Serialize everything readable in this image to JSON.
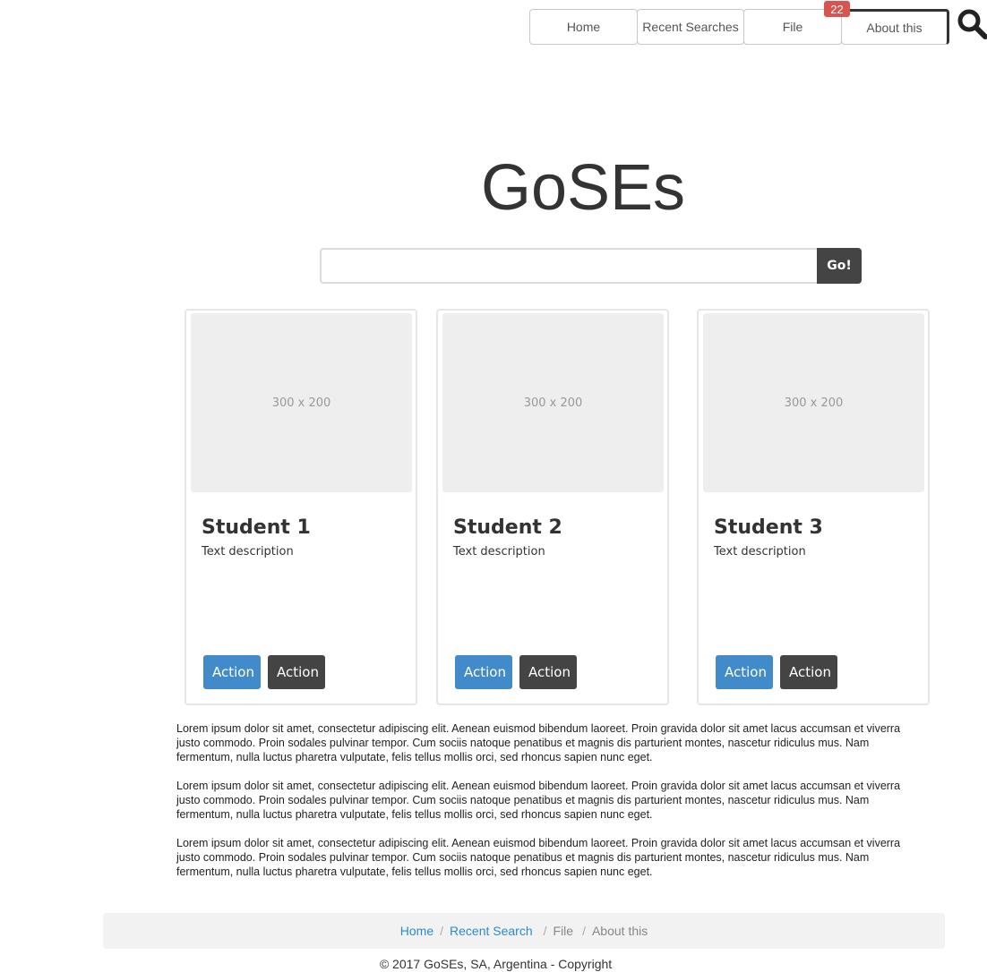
{
  "nav": {
    "items": [
      {
        "label": "Home"
      },
      {
        "label": "Recent Searches"
      },
      {
        "label": "File"
      },
      {
        "label": "About this"
      }
    ],
    "badge": "22"
  },
  "icons": {
    "search": "search-icon"
  },
  "hero": {
    "title": "GoSEs",
    "search_value": "",
    "search_placeholder": "",
    "go_label": "Go!"
  },
  "cards": [
    {
      "thumb": "300 x 200",
      "title": "Student 1",
      "description": "Text description",
      "action1": "Action",
      "action2": "Action"
    },
    {
      "thumb": "300 x 200",
      "title": "Student 2",
      "description": "Text description",
      "action1": "Action",
      "action2": "Action"
    },
    {
      "thumb": "300 x 200",
      "title": "Student 3",
      "description": "Text description",
      "action1": "Action",
      "action2": "Action"
    }
  ],
  "paragraphs": [
    "Lorem ipsum dolor sit amet, consectetur adipiscing elit. Aenean euismod bibendum laoreet. Proin gravida dolor sit amet lacus accumsan et viverra justo commodo. Proin sodales pulvinar tempor. Cum sociis natoque penatibus et magnis dis parturient montes, nascetur ridiculus mus. Nam fermentum, nulla luctus pharetra vulputate, felis tellus mollis orci, sed rhoncus sapien nunc eget.",
    "Lorem ipsum dolor sit amet, consectetur adipiscing elit. Aenean euismod bibendum laoreet. Proin gravida dolor sit amet lacus accumsan et viverra justo commodo. Proin sodales pulvinar tempor. Cum sociis natoque penatibus et magnis dis parturient montes, nascetur ridiculus mus. Nam fermentum, nulla luctus pharetra vulputate, felis tellus mollis orci, sed rhoncus sapien nunc eget.",
    "Lorem ipsum dolor sit amet, consectetur adipiscing elit. Aenean euismod bibendum laoreet. Proin gravida dolor sit amet lacus accumsan et viverra justo commodo. Proin sodales pulvinar tempor. Cum sociis natoque penatibus et magnis dis parturient montes, nascetur ridiculus mus. Nam fermentum, nulla luctus pharetra vulputate, felis tellus mollis orci, sed rhoncus sapien nunc eget."
  ],
  "breadcrumb": {
    "items": [
      "Home",
      "Recent Search",
      "File",
      "About this"
    ],
    "separator": "/"
  },
  "footer": {
    "copyright": "© 2017 GoSEs, SA, Argentina - Copyright"
  },
  "colors": {
    "primary": "#428bca",
    "dark": "#444444",
    "badge": "#d9534f",
    "link": "#2a8bd0"
  }
}
